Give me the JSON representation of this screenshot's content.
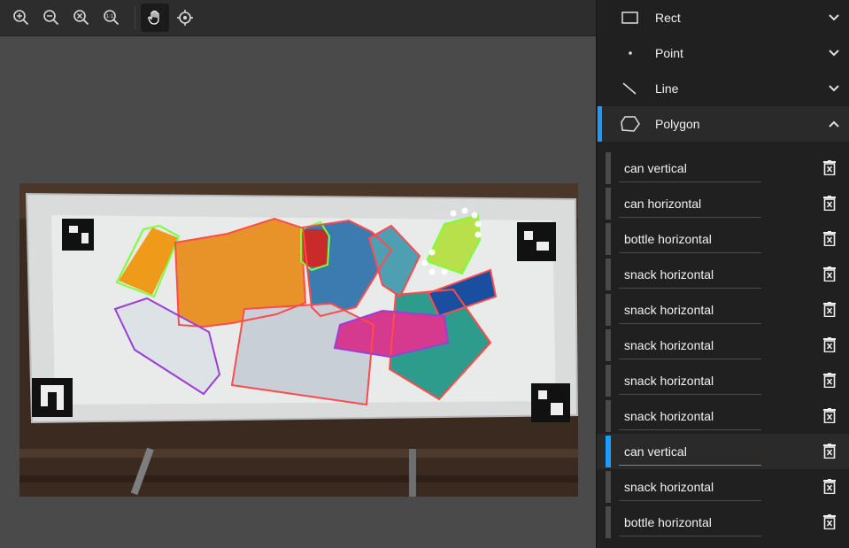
{
  "toolbar": {
    "icons": [
      "zoom-in-icon",
      "zoom-out-icon",
      "zoom-fit-icon",
      "zoom-reset-icon",
      "hand-pan-icon",
      "target-center-icon"
    ],
    "zoom_reset_text": "1:1"
  },
  "sidebar": {
    "sections": [
      {
        "label": "Rect",
        "icon": "rect-icon",
        "expanded": false
      },
      {
        "label": "Point",
        "icon": "point-icon",
        "expanded": false
      },
      {
        "label": "Line",
        "icon": "line-icon",
        "expanded": false
      },
      {
        "label": "Polygon",
        "icon": "polygon-icon",
        "expanded": true
      }
    ],
    "polygon_items": [
      {
        "label": "can vertical",
        "active": false
      },
      {
        "label": "can horizontal",
        "active": false
      },
      {
        "label": "bottle horizontal",
        "active": false
      },
      {
        "label": "snack horizontal",
        "active": false
      },
      {
        "label": "snack horizontal",
        "active": false
      },
      {
        "label": "snack horizontal",
        "active": false
      },
      {
        "label": "snack horizontal",
        "active": false
      },
      {
        "label": "snack horizontal",
        "active": false
      },
      {
        "label": "can vertical",
        "active": true
      },
      {
        "label": "snack horizontal",
        "active": false
      },
      {
        "label": "bottle horizontal",
        "active": false
      }
    ]
  },
  "colors": {
    "accent": "#1e9bff",
    "can_outline": "#7cff3a",
    "bottle_outline": "#9a3fd6",
    "snack_outline": "#ff4b4b"
  }
}
